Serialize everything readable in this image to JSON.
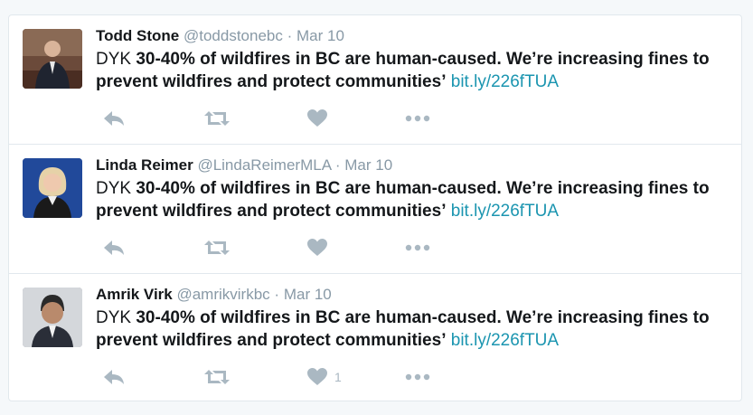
{
  "tweets": [
    {
      "fullname": "Todd Stone",
      "username": "@toddstonebc",
      "sep": "·",
      "time": "Mar 10",
      "text_prefix": "DYK ",
      "text_bold": "30-40% of wildfires in BC are human-caused. We’re increasing fines to prevent wildfires and protect communities’",
      "link": "bit.ly/226fTUA",
      "like_count": ""
    },
    {
      "fullname": "Linda Reimer",
      "username": "@LindaReimerMLA",
      "sep": "·",
      "time": "Mar 10",
      "text_prefix": "DYK ",
      "text_bold": "30-40% of wildfires in BC are human-caused. We’re increasing fines to prevent wildfires and protect communities’",
      "link": "bit.ly/226fTUA",
      "like_count": ""
    },
    {
      "fullname": "Amrik Virk",
      "username": "@amrikvirkbc",
      "sep": "·",
      "time": "Mar 10",
      "text_prefix": "DYK ",
      "text_bold": "30-40% of wildfires in BC are human-caused. We’re increasing fines to prevent wildfires and protect communities’",
      "link": "bit.ly/226fTUA",
      "like_count": "1"
    }
  ],
  "icons": {
    "reply": "reply-icon",
    "retweet": "retweet-icon",
    "like": "heart-icon",
    "more": "more-dots-icon"
  },
  "colors": {
    "icon": "#aab8c2",
    "link": "#1b95b0",
    "muted": "#8899a6",
    "border": "#e1e8ed"
  }
}
